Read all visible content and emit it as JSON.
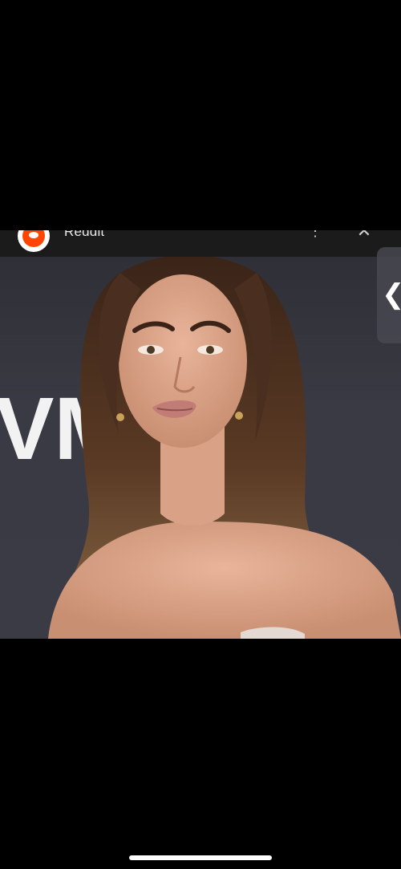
{
  "app_bar": {
    "title": "Reddit",
    "logo_icon": "reddit-logo-icon",
    "more_icon": "more-vertical-icon",
    "more_glyph": "⋮",
    "close_icon": "close-icon",
    "close_glyph": "✕"
  },
  "image": {
    "backdrop_text": "VM"
  },
  "side_handle": {
    "icon": "chevron-left-icon",
    "glyph": "❮"
  },
  "colors": {
    "app_bar_bg": "#1b1b1c",
    "backdrop": "#3a3a44",
    "reddit_orange": "#ff4500"
  }
}
